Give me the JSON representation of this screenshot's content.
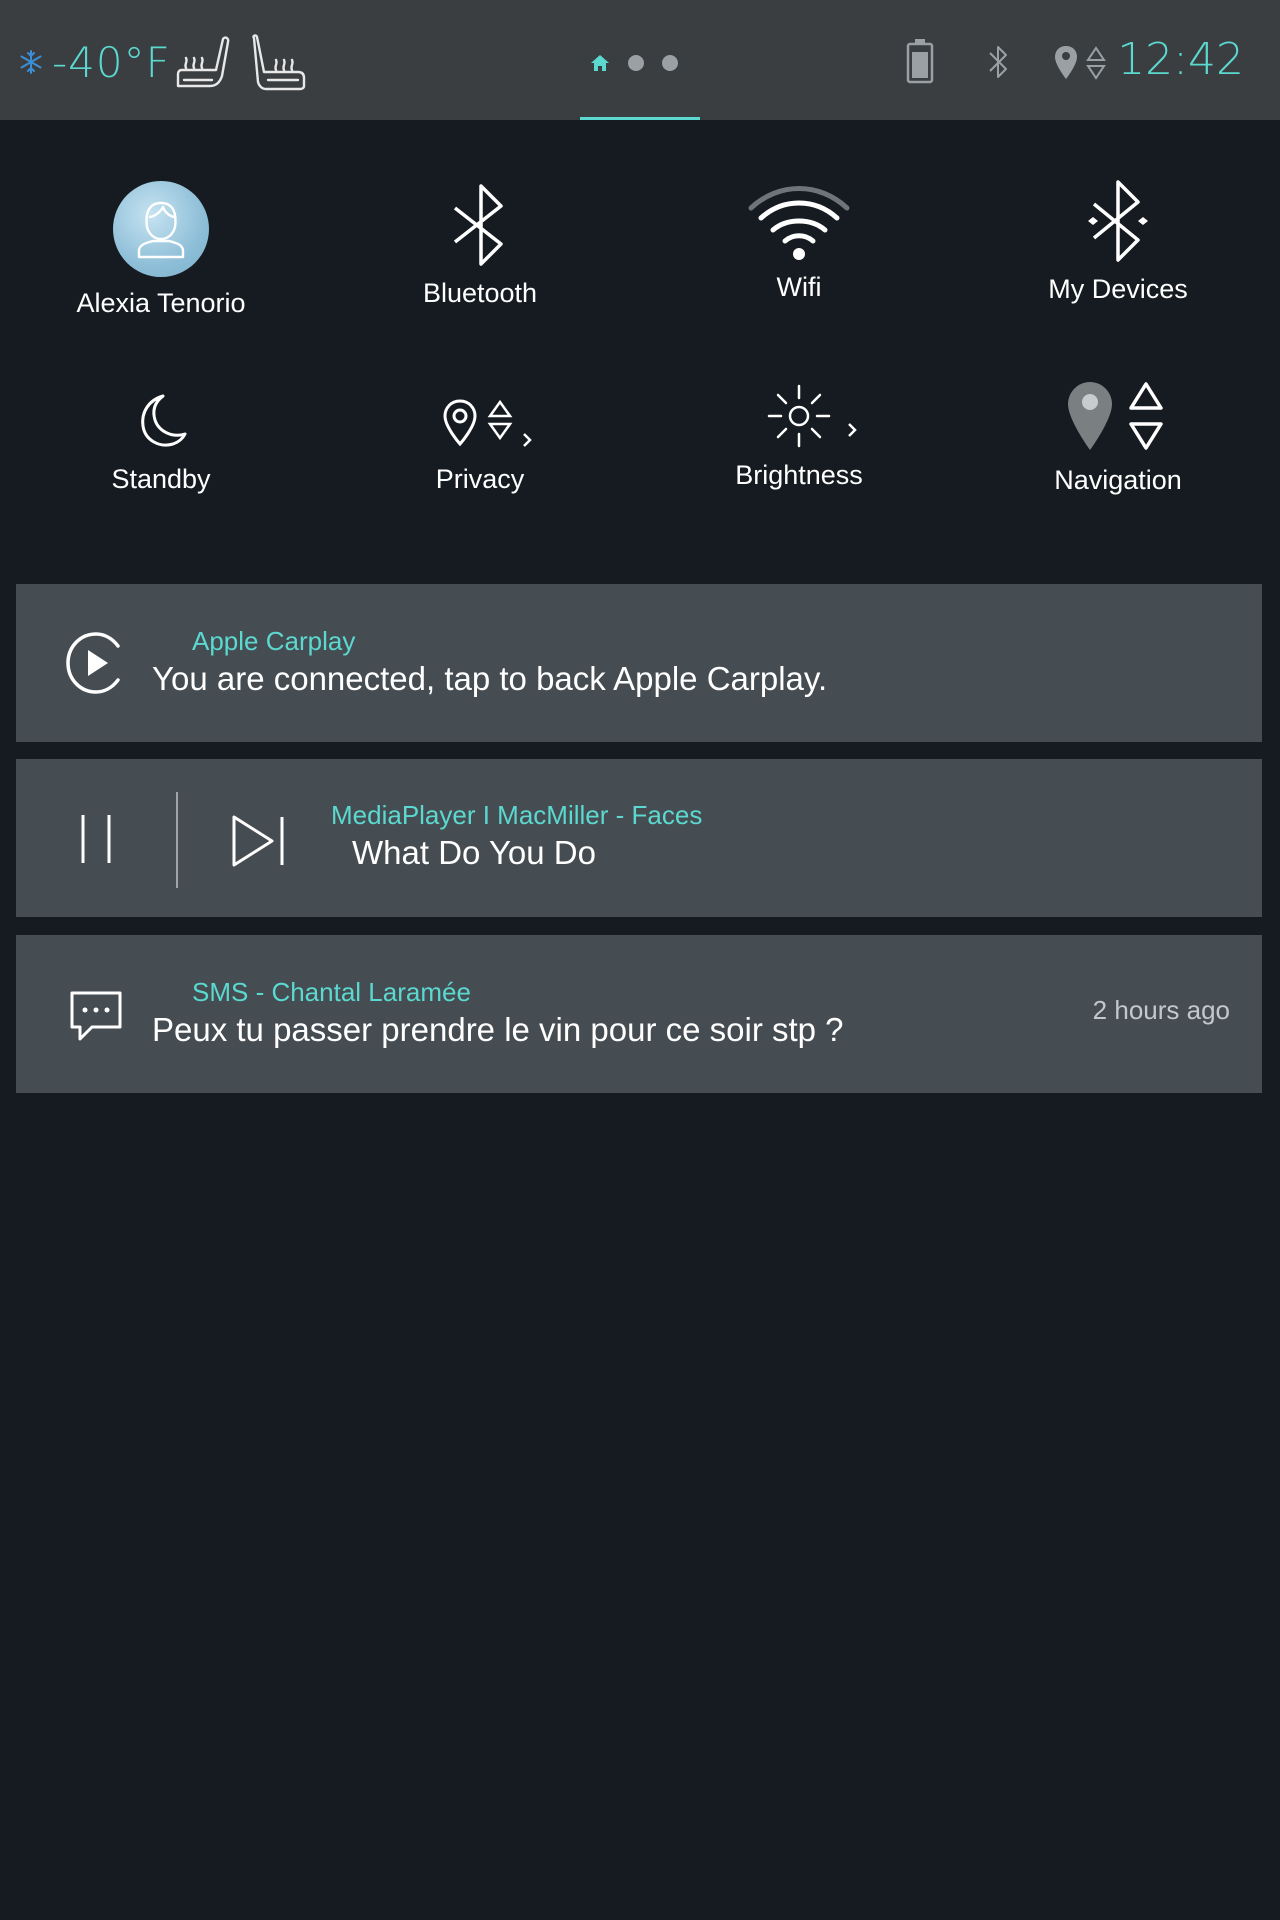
{
  "status_bar": {
    "temperature": "-40°F",
    "clock": "12:42",
    "page_count": 3,
    "active_page": 1,
    "icons": [
      "snowflake-icon",
      "seat-heat-icon",
      "seat-heat-rear-icon",
      "home-icon",
      "battery-icon",
      "bluetooth-icon",
      "location-nav-icon"
    ]
  },
  "tiles": {
    "profile": "Alexia Tenorio",
    "bluetooth": "Bluetooth",
    "wifi": "Wifi",
    "my_devices": "My Devices",
    "standby": "Standby",
    "privacy": "Privacy",
    "brightness": "Brightness",
    "navigation": "Navigation"
  },
  "notifications": {
    "carplay": {
      "title": "Apple Carplay",
      "body": "You are connected, tap to back Apple Carplay."
    },
    "media": {
      "title": "MediaPlayer I MacMiller - Faces",
      "body": "What Do You Do"
    },
    "sms": {
      "title": "SMS - Chantal Laramée",
      "body": "Peux tu passer prendre le vin pour ce soir stp ?",
      "time": "2 hours ago"
    }
  },
  "colors": {
    "accent": "#5bd8cf",
    "background": "#151b21",
    "status_bar": "#3b3e41",
    "card": "#464d52"
  }
}
